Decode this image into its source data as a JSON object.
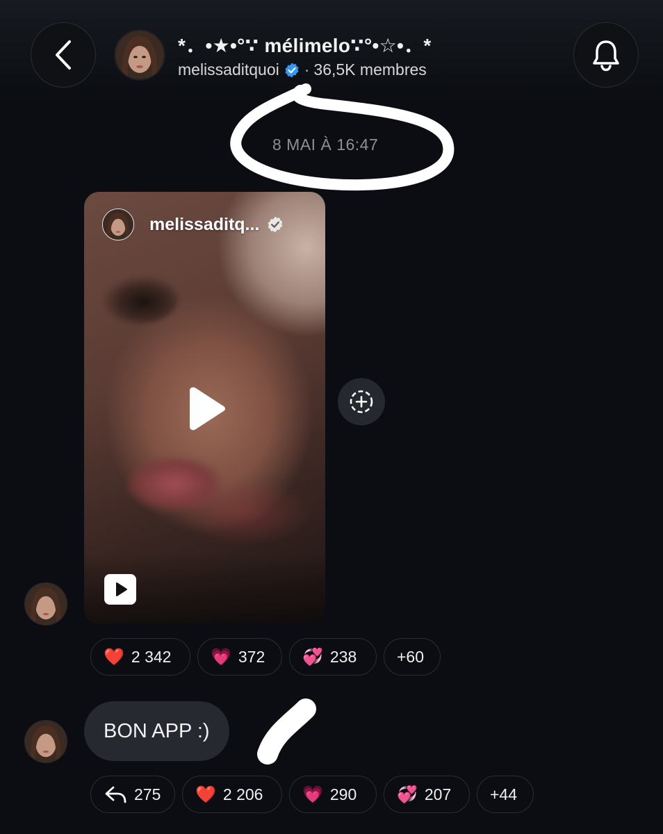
{
  "header": {
    "back_icon": "chevron-left-icon",
    "title": "*．•★•°∵ mélimelo∵°•☆•．*",
    "username": "melissaditquoi",
    "verified_icon": "verified-badge-icon",
    "separator": "·",
    "members": "36,5K membres",
    "bell_icon": "bell-icon"
  },
  "timestamp": "8 MAI À 16:47",
  "reel": {
    "username": "melissaditq...",
    "play_icon": "play-icon",
    "reel_icon": "reel-icon"
  },
  "add_icon": "add-to-story-icon",
  "message_reactions": [
    {
      "emoji": "❤️",
      "count": "2 342"
    },
    {
      "emoji": "💗",
      "count": "372"
    },
    {
      "emoji": "💞",
      "count": "238"
    },
    {
      "emoji": "",
      "count": "+60"
    }
  ],
  "text_message": {
    "text": "BON APP :)"
  },
  "text_reactions": [
    {
      "emoji": "reply-icon",
      "count": "275"
    },
    {
      "emoji": "❤️",
      "count": "2 206"
    },
    {
      "emoji": "💗",
      "count": "290"
    },
    {
      "emoji": "💞",
      "count": "207"
    },
    {
      "emoji": "",
      "count": "+44"
    }
  ],
  "colors": {
    "background": "#0b0d12",
    "verified": "#3897f0",
    "bubble": "#26292f",
    "timestamp": "#8a8f98"
  }
}
